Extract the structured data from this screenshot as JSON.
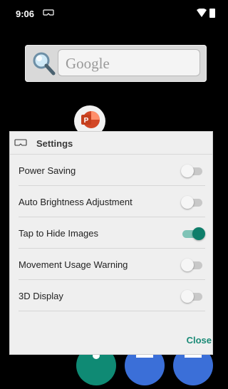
{
  "status_bar": {
    "time": "9:06"
  },
  "search_widget": {
    "placeholder": "Google"
  },
  "settings": {
    "title": "Settings",
    "items": [
      {
        "label": "Power Saving",
        "on": false
      },
      {
        "label": "Auto Brightness Adjustment",
        "on": false
      },
      {
        "label": "Tap to Hide Images",
        "on": true
      },
      {
        "label": "Movement Usage Warning",
        "on": false
      },
      {
        "label": "3D Display",
        "on": false
      }
    ],
    "close_label": "Close",
    "accent_color": "#0e7e6a"
  },
  "icons": {
    "status": [
      "vr-headset-icon",
      "wifi-icon",
      "battery-icon"
    ],
    "search": "magnifier-icon",
    "app": "powerpoint-icon",
    "dock": [
      "phone-icon",
      "messages-icon",
      "browser-icon"
    ]
  }
}
